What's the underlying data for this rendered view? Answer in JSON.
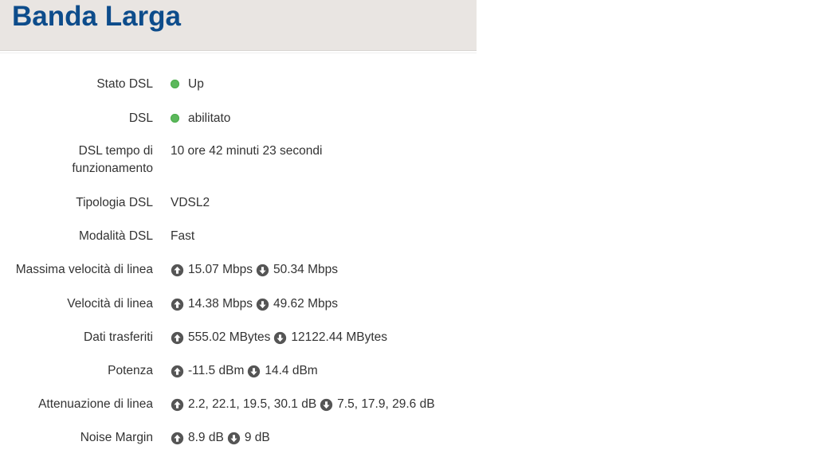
{
  "header": {
    "title": "Banda Larga"
  },
  "colors": {
    "title": "#0d4c8b",
    "header_bg": "#e9e5e2",
    "status_ok": "#5cb85c",
    "text": "#333333"
  },
  "rows": {
    "stato_dsl": {
      "label": "Stato DSL",
      "value": "Up",
      "status_icon": "green-dot-icon"
    },
    "dsl": {
      "label": "DSL",
      "value": "abilitato",
      "status_icon": "green-dot-icon"
    },
    "tempo": {
      "label_line1": "DSL tempo di",
      "label_line2": "funzionamento",
      "value": "10 ore 42 minuti 23 secondi"
    },
    "tipologia": {
      "label": "Tipologia DSL",
      "value": "VDSL2"
    },
    "modalita": {
      "label": "Modalità DSL",
      "value": "Fast"
    },
    "massima_velocita": {
      "label": "Massima velocità di linea",
      "up": "15.07 Mbps",
      "down": "50.34 Mbps"
    },
    "velocita": {
      "label": "Velocità di linea",
      "up": "14.38 Mbps",
      "down": "49.62 Mbps"
    },
    "dati": {
      "label": "Dati trasferiti",
      "up": "555.02 MBytes",
      "down": "12122.44 MBytes"
    },
    "potenza": {
      "label": "Potenza",
      "up": "-11.5 dBm",
      "down": "14.4 dBm"
    },
    "attenuazione": {
      "label": "Attenuazione di linea",
      "up": "2.2, 22.1, 19.5, 30.1 dB",
      "down": "7.5, 17.9, 29.6 dB"
    },
    "noise": {
      "label": "Noise Margin",
      "up": "8.9 dB",
      "down": "9 dB"
    }
  },
  "icons": {
    "up": "arrow-up-circle-icon",
    "down": "arrow-down-circle-icon"
  }
}
